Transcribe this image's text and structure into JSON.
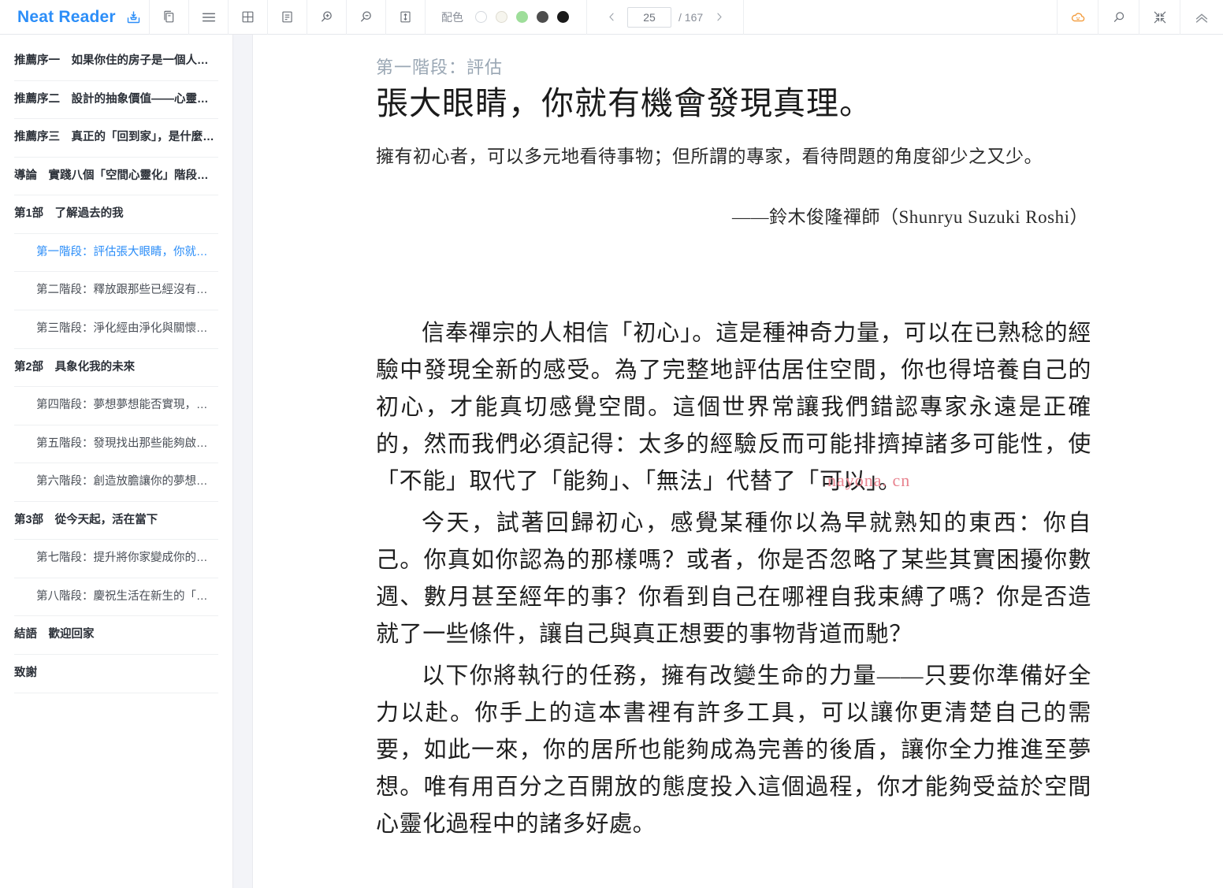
{
  "toolbar": {
    "brand": "Neat Reader",
    "brand_color": "#2c8ef8",
    "icons": {
      "save": "save-to-bookshelf-icon",
      "copy": "duplicate-pages-icon",
      "menu": "hamburger-menu-icon",
      "grid": "grid-layout-icon",
      "notes": "notes-panel-icon",
      "zoom_in": "zoom-in-icon",
      "zoom_out": "zoom-out-icon",
      "fit_height": "fit-height-icon",
      "cloud": "cloud-sync-icon",
      "search": "search-icon",
      "compress": "compress-icon",
      "collapse": "collapse-chevrons-up-icon"
    },
    "color_scheme": {
      "label": "配色",
      "swatches": [
        {
          "name": "white",
          "hex": "#ffffff"
        },
        {
          "name": "cream",
          "hex": "#f6f5ee"
        },
        {
          "name": "green",
          "hex": "#9ede9a"
        },
        {
          "name": "gray",
          "hex": "#4d4d4d"
        },
        {
          "name": "black",
          "hex": "#1a1a1a"
        }
      ],
      "selected_index": 0
    },
    "pager": {
      "prev_label": "‹",
      "next_label": "›",
      "current_page": "25",
      "page_placeholder": "25",
      "total_label": "/ 167"
    },
    "cloud_color": "#f39c3d"
  },
  "sidebar": {
    "items": [
      {
        "label": "推薦序一　如果你住的房子是一個人，…",
        "level": 1,
        "active": false
      },
      {
        "label": "推薦序二　設計的抽象價值——心靈整修",
        "level": 1,
        "active": false
      },
      {
        "label": "推薦序三　真正的「回到家」，是什麼…",
        "level": 1,
        "active": false
      },
      {
        "label": "導論　實踐八個「空間心靈化」階段，…",
        "level": 1,
        "active": false
      },
      {
        "label": "第1部　了解過去的我",
        "level": 1,
        "active": false
      },
      {
        "label": "第一階段：評估張大眼睛，你就…",
        "level": 2,
        "active": true
      },
      {
        "label": "第二階段：釋放跟那些已經沒有…",
        "level": 2,
        "active": false
      },
      {
        "label": "第三階段：淨化經由淨化與關懷…",
        "level": 2,
        "active": false
      },
      {
        "label": "第2部　具象化我的未來",
        "level": 1,
        "active": false
      },
      {
        "label": "第四階段：夢想夢想能否實現，…",
        "level": 2,
        "active": false
      },
      {
        "label": "第五階段：發現找出那些能夠啟…",
        "level": 2,
        "active": false
      },
      {
        "label": "第六階段：創造放膽讓你的夢想…",
        "level": 2,
        "active": false
      },
      {
        "label": "第3部　從今天起，活在當下",
        "level": 1,
        "active": false
      },
      {
        "label": "第七階段：提升將你家變成你的…",
        "level": 2,
        "active": false
      },
      {
        "label": "第八階段：慶祝生活在新生的「…",
        "level": 2,
        "active": false
      },
      {
        "label": "結語　歡迎回家",
        "level": 1,
        "active": false
      },
      {
        "label": "致謝",
        "level": 1,
        "active": false
      }
    ]
  },
  "reader": {
    "kicker": "第一階段：評估",
    "title": "張大眼睛，你就有機會發現真理。",
    "epigraph": "擁有初心者，可以多元地看待事物；但所謂的專家，看待問題的角度卻少之又少。",
    "epigraph_source": "——鈴木俊隆禪師（Shunryu Suzuki Roshi）",
    "paragraphs": [
      "信奉禪宗的人相信「初心」。這是種神奇力量，可以在已熟稔的經驗中發現全新的感受。為了完整地評估居住空間，你也得培養自己的初心，才能真切感覺空間。這個世界常讓我們錯認專家永遠是正確的，然而我們必須記得：太多的經驗反而可能排擠掉諸多可能性，使「不能」取代了「能夠」、「無法」代替了「可以」。",
      "今天，試著回歸初心，感覺某種你以為早就熟知的東西：你自己。你真如你認為的那樣嗎？或者，你是否忽略了某些其實困擾你數週、數月甚至經年的事？你看到自己在哪裡自我束縛了嗎？你是否造就了一些條件，讓自己與真正想要的事物背道而馳？",
      "以下你將執行的任務，擁有改變生命的力量——只要你準備好全力以赴。你手上的這本書裡有許多工具，可以讓你更清楚自己的需要，如此一來，你的居所也能夠成為完善的後盾，讓你全力推進至夢想。唯有用百分之百開放的態度投入這個過程，你才能夠受益於空間心靈化過程中的諸多好處。"
    ],
    "watermark": "nayona. cn",
    "watermark_color": "#e8838f"
  }
}
